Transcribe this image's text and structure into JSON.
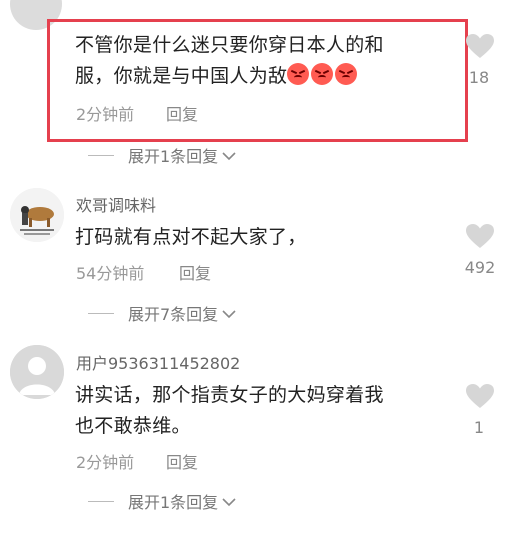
{
  "comments": [
    {
      "text_line1": "不管你是什么迷只要你穿日本人的和",
      "text_line2": "服，你就是与中国人为敌",
      "emoji_icons": [
        "angry-face-icon",
        "angry-face-icon",
        "angry-face-icon"
      ],
      "time": "2分钟前",
      "reply": "回复",
      "likes": "18",
      "expand": "展开1条回复"
    },
    {
      "username": "欢哥调味料",
      "text_line1": "打码就有点对不起大家了，",
      "time": "54分钟前",
      "reply": "回复",
      "likes": "492",
      "expand": "展开7条回复"
    },
    {
      "username": "用户9536311452802",
      "text_line1": "讲实话，那个指责女子的大妈穿着我",
      "text_line2": "也不敢恭维。",
      "time": "2分钟前",
      "reply": "回复",
      "likes": "1",
      "expand": "展开1条回复"
    }
  ],
  "colors": {
    "highlight_border": "#e5404e",
    "heart": "#d6d6d6"
  }
}
